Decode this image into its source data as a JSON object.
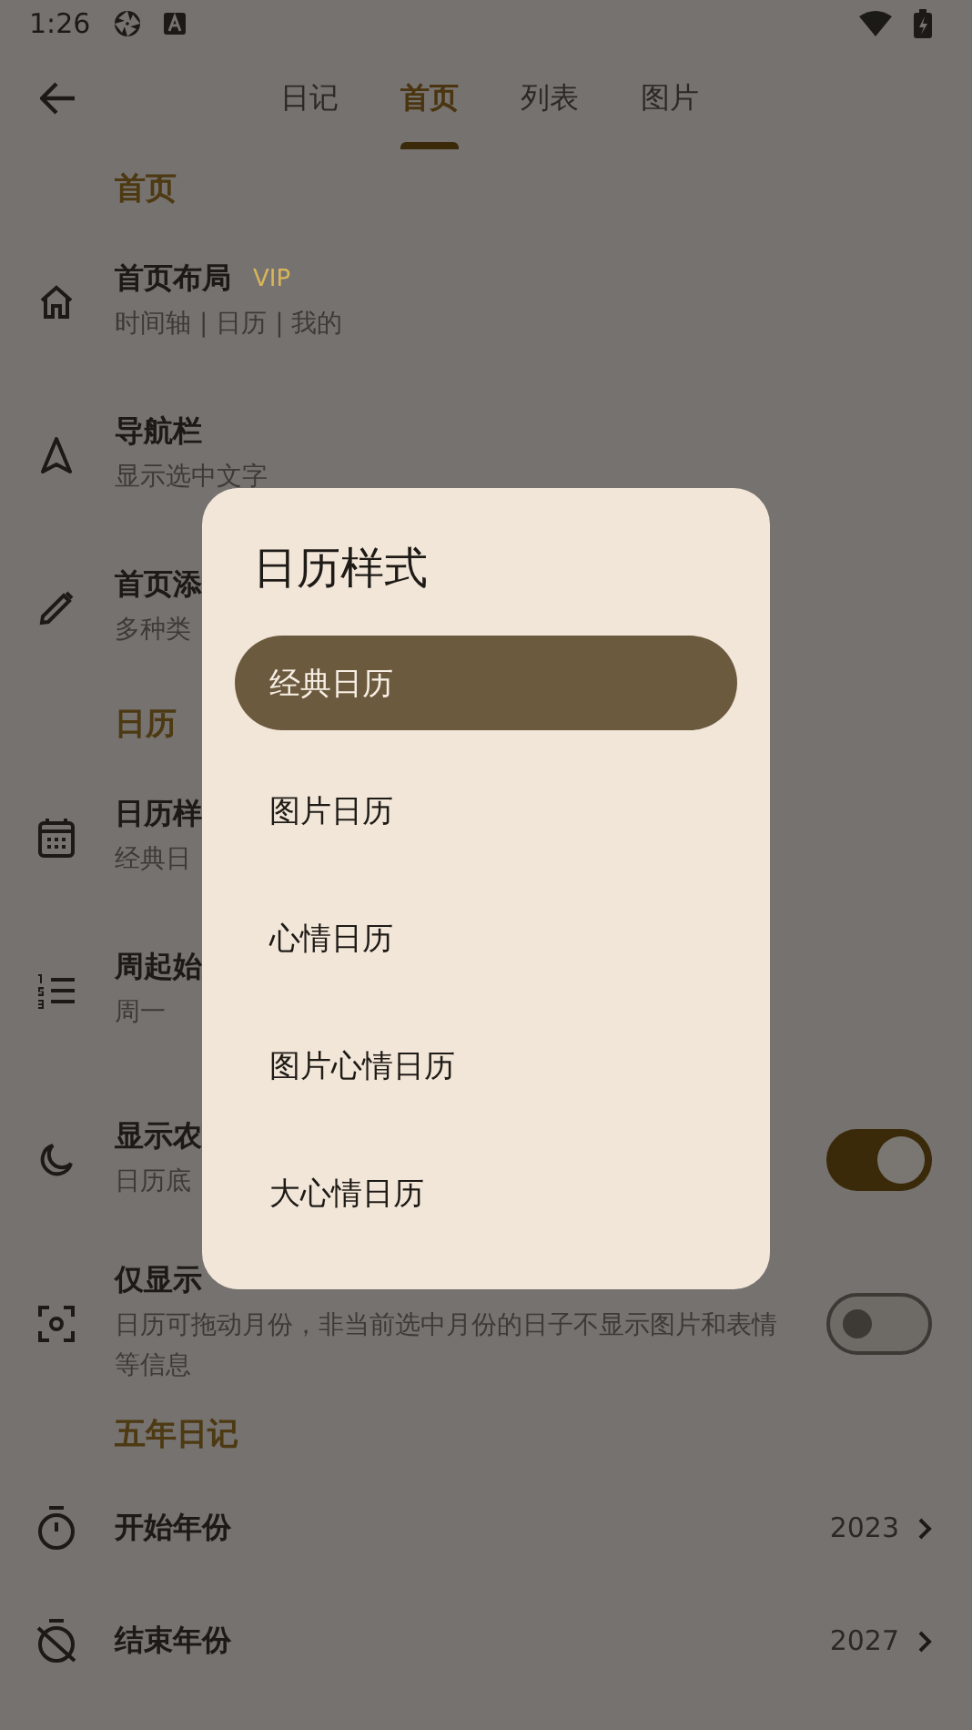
{
  "status_bar": {
    "time": "1:26"
  },
  "tabs": [
    {
      "label": "日记",
      "selected": false
    },
    {
      "label": "首页",
      "selected": true
    },
    {
      "label": "列表",
      "selected": false
    },
    {
      "label": "图片",
      "selected": false
    }
  ],
  "sections": [
    {
      "title": "首页",
      "items": [
        {
          "kind": "nav",
          "title": "首页布局",
          "badge": "VIP",
          "subtitle": "时间轴 | 日历 | 我的"
        },
        {
          "kind": "nav",
          "title": "导航栏",
          "subtitle": "显示选中文字"
        },
        {
          "kind": "nav",
          "title": "首页添",
          "subtitle": "多种类"
        }
      ]
    },
    {
      "title": "日历",
      "items": [
        {
          "kind": "nav",
          "title": "日历样",
          "subtitle": "经典日"
        },
        {
          "kind": "nav",
          "title": "周起始",
          "subtitle": "周一"
        },
        {
          "kind": "toggle",
          "title": "显示农",
          "subtitle": "日历底",
          "on": true
        },
        {
          "kind": "toggle",
          "title": "仅显示",
          "subtitle": "日历可拖动月份，非当前选中月份的日子不显示图片和表情等信息",
          "on": false
        }
      ]
    },
    {
      "title": "五年日记",
      "items": [
        {
          "kind": "value",
          "title": "开始年份",
          "value": "2023"
        },
        {
          "kind": "value",
          "title": "结束年份",
          "value": "2027"
        }
      ]
    }
  ],
  "dialog": {
    "title": "日历样式",
    "options": [
      {
        "label": "经典日历",
        "selected": true
      },
      {
        "label": "图片日历",
        "selected": false
      },
      {
        "label": "心情日历",
        "selected": false
      },
      {
        "label": "图片心情日历",
        "selected": false
      },
      {
        "label": "大心情日历",
        "selected": false
      }
    ]
  }
}
